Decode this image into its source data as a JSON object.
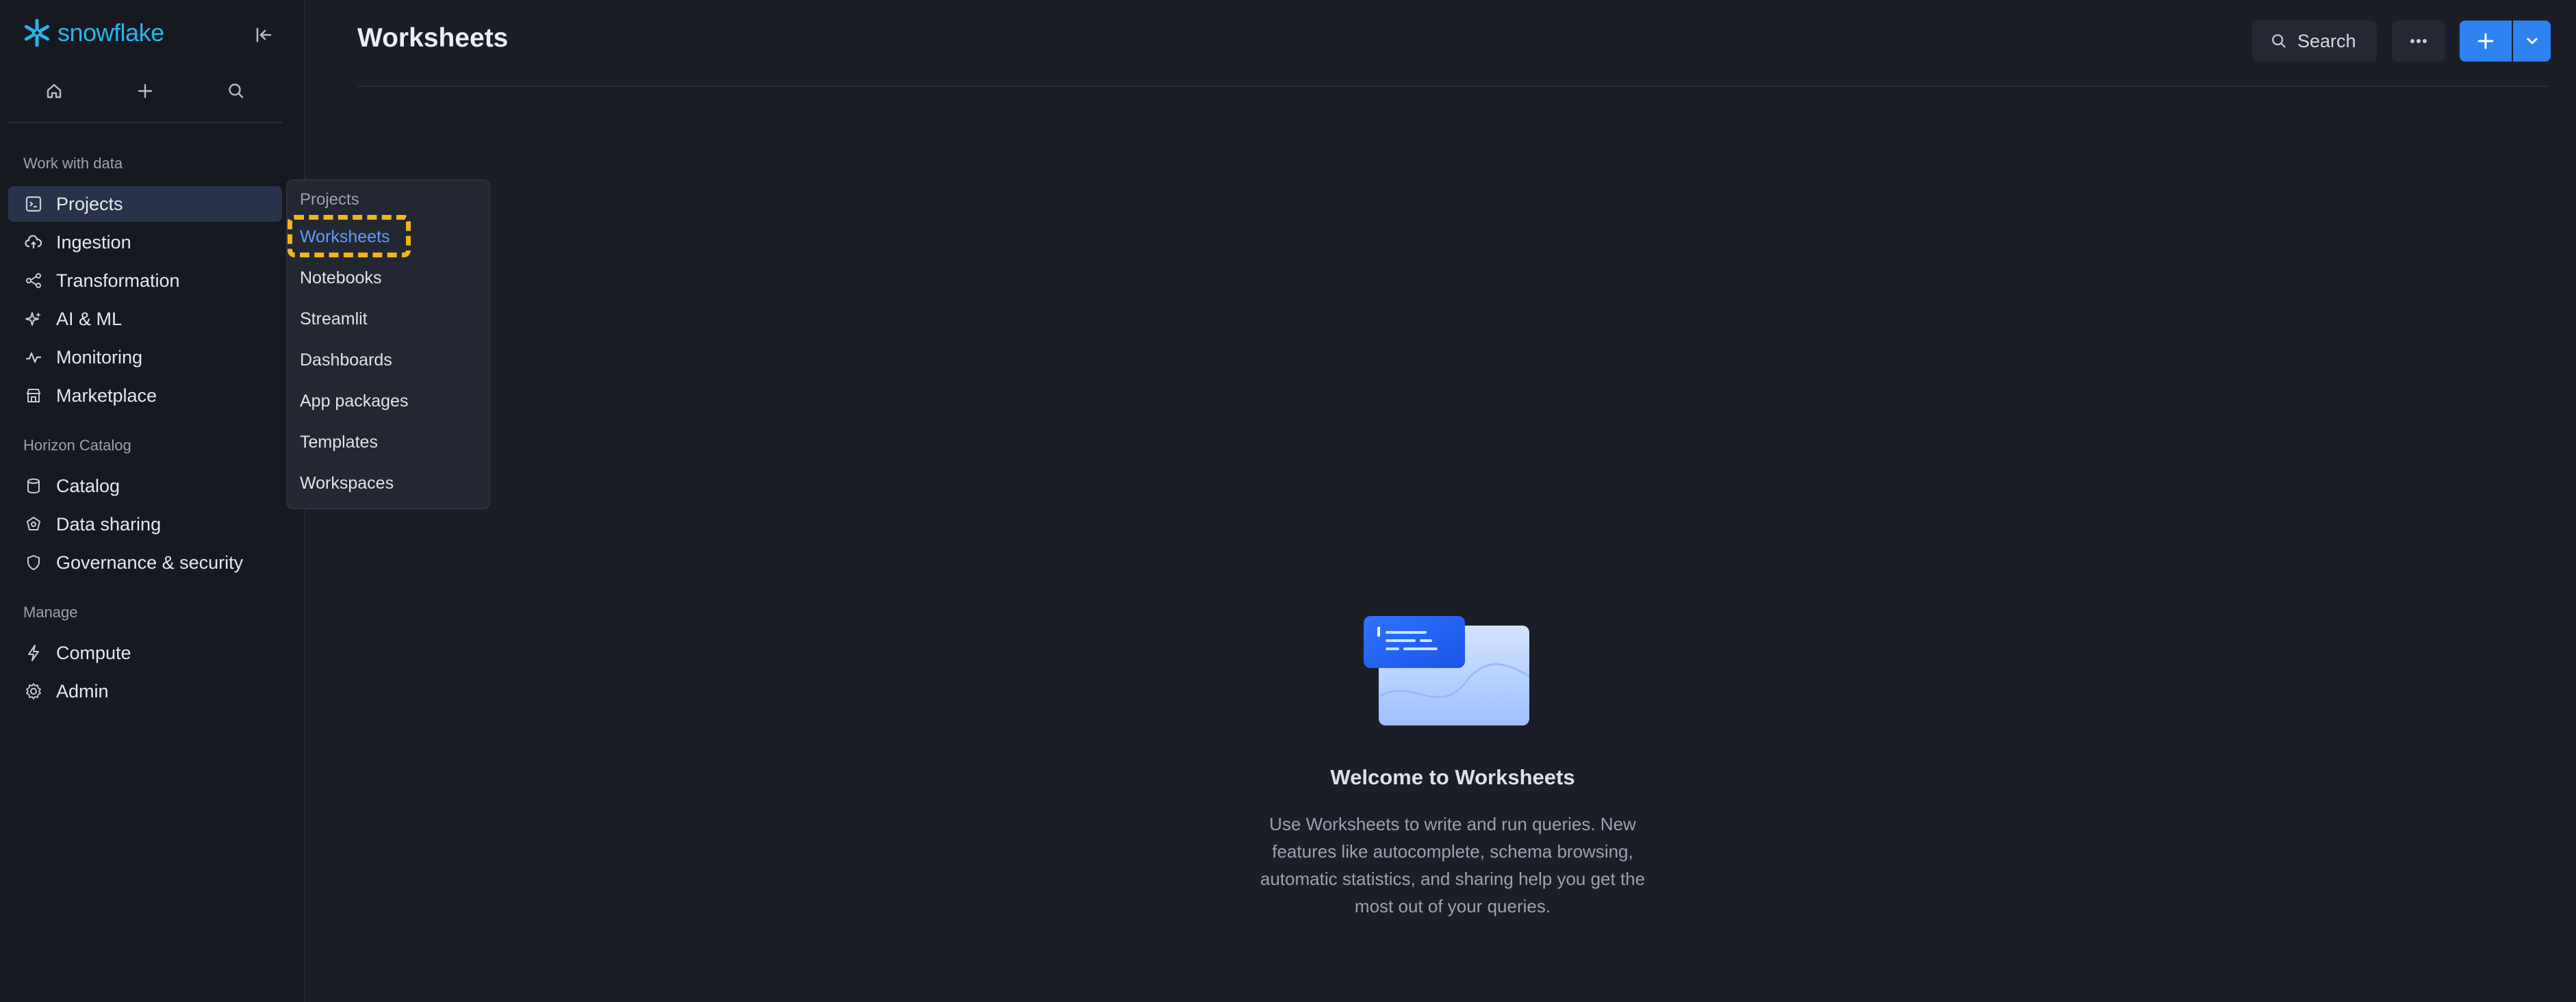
{
  "app": {
    "brand": "snowflake",
    "page_title": "Worksheets"
  },
  "sidebar": {
    "sections": [
      {
        "title": "Work with data",
        "items": [
          "Projects",
          "Ingestion",
          "Transformation",
          "AI & ML",
          "Monitoring",
          "Marketplace"
        ]
      },
      {
        "title": "Horizon Catalog",
        "items": [
          "Catalog",
          "Data sharing",
          "Governance & security"
        ]
      },
      {
        "title": "Manage",
        "items": [
          "Compute",
          "Admin"
        ]
      }
    ],
    "active_item": "Projects"
  },
  "header": {
    "search_label": "Search"
  },
  "flyout": {
    "title": "Projects",
    "items": [
      "Worksheets",
      "Notebooks",
      "Streamlit",
      "Dashboards",
      "App packages",
      "Templates",
      "Workspaces"
    ],
    "selected": "Worksheets"
  },
  "empty_state": {
    "title": "Welcome to Worksheets",
    "description": "Use Worksheets to write and run queries. New features like autocomplete, schema browsing, automatic statistics, and sharing help you get the most out of your queries."
  },
  "colors": {
    "accent": "#2d82f0",
    "brand": "#29b5e8",
    "highlight": "#f2b51e",
    "selected_link": "#5e9bff"
  }
}
